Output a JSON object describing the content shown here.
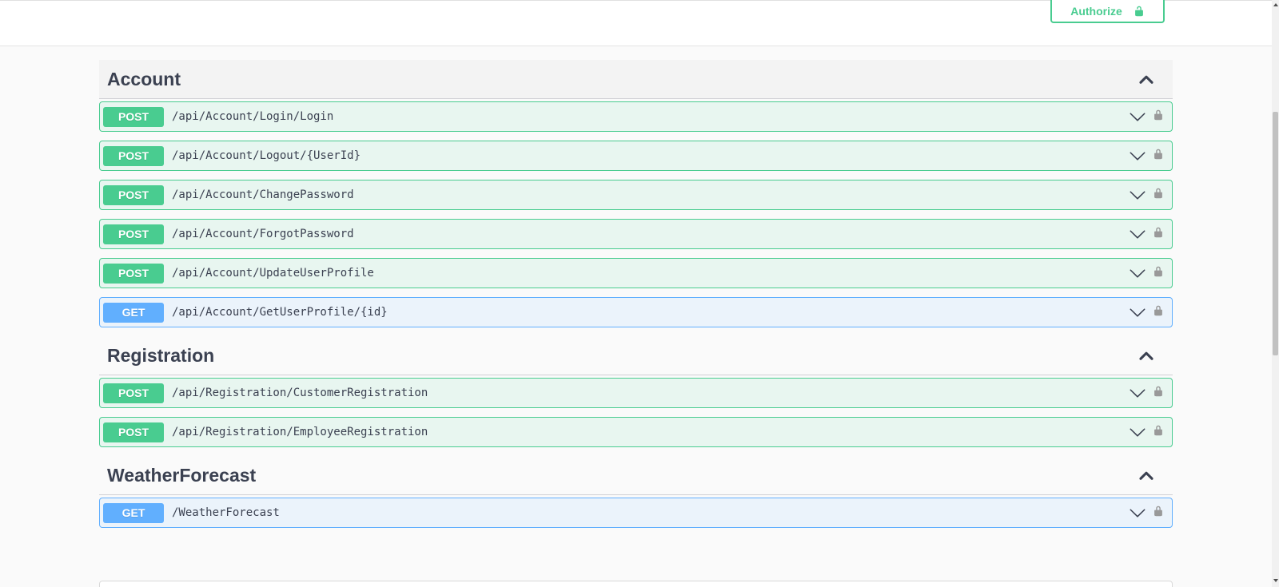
{
  "header": {
    "authorize_label": "Authorize"
  },
  "tags": [
    {
      "name": "Account",
      "operations": [
        {
          "method": "POST",
          "path": "/api/Account/Login/Login"
        },
        {
          "method": "POST",
          "path": "/api/Account/Logout/{UserId}"
        },
        {
          "method": "POST",
          "path": "/api/Account/ChangePassword"
        },
        {
          "method": "POST",
          "path": "/api/Account/ForgotPassword"
        },
        {
          "method": "POST",
          "path": "/api/Account/UpdateUserProfile"
        },
        {
          "method": "GET",
          "path": "/api/Account/GetUserProfile/{id}"
        }
      ]
    },
    {
      "name": "Registration",
      "operations": [
        {
          "method": "POST",
          "path": "/api/Registration/CustomerRegistration"
        },
        {
          "method": "POST",
          "path": "/api/Registration/EmployeeRegistration"
        }
      ]
    },
    {
      "name": "WeatherForecast",
      "operations": [
        {
          "method": "GET",
          "path": "/WeatherForecast"
        }
      ]
    }
  ],
  "colors": {
    "post": "#49cc90",
    "get": "#61affe"
  }
}
